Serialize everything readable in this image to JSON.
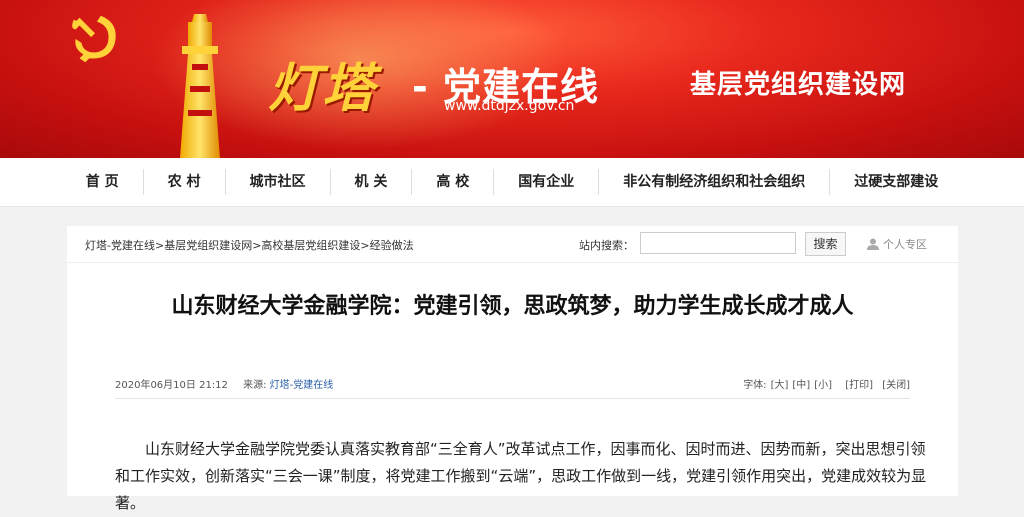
{
  "banner": {
    "logo_main": "灯塔",
    "logo_sub": "- 党建在线",
    "logo_url": "www.dtdjzx.gov.cn",
    "site_name": "基层党组织建设网"
  },
  "nav": {
    "items": [
      "首 页",
      "农 村",
      "城市社区",
      "机 关",
      "高 校",
      "国有企业",
      "非公有制经济组织和社会组织",
      "过硬支部建设"
    ]
  },
  "breadcrumb": {
    "items": [
      "灯塔-党建在线",
      ">基层党组织建设网",
      ">高校基层党组织建设",
      ">经验做法"
    ]
  },
  "search": {
    "label": "站内搜索：",
    "placeholder": "",
    "button": "搜索"
  },
  "user_zone": {
    "label": "个人专区",
    "icon": "user-icon"
  },
  "article": {
    "title": "山东财经大学金融学院：党建引领，思政筑梦，助力学生成长成才成人",
    "date": "2020年06月10日 21:12",
    "source_label": "来源:",
    "source": "灯塔-党建在线",
    "font_label": "字体:",
    "font_large": "[大]",
    "font_medium": "[中]",
    "font_small": "[小]",
    "print": "[打印]",
    "close": "[关闭]",
    "body": "山东财经大学金融学院党委认真落实教育部“三全育人”改革试点工作，因事而化、因时而进、因势而新，突出思想引领和工作实效，创新落实“三会一课”制度，将党建工作搬到“云端”，思政工作做到一线，党建引领作用突出，党建成效较为显著。"
  },
  "colors": {
    "banner_red": "#d21a14",
    "logo_gold": "#ffd23a",
    "link_blue": "#2a5ea8"
  }
}
